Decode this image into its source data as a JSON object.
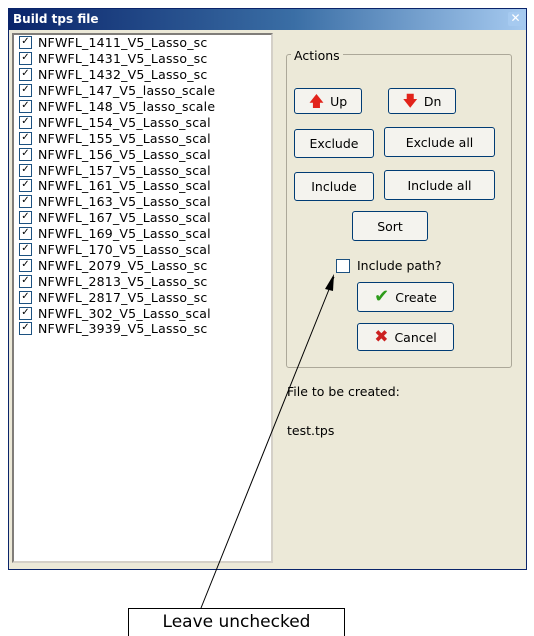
{
  "window": {
    "title": "Build tps file",
    "close_icon": "close-icon"
  },
  "files": [
    "NFWFL_1411_V5_Lasso_sc",
    "NFWFL_1431_V5_Lasso_sc",
    "NFWFL_1432_V5_Lasso_sc",
    "NFWFL_147_V5_lasso_scale",
    "NFWFL_148_V5_lasso_scale",
    "NFWFL_154_V5_Lasso_scal",
    "NFWFL_155_V5_Lasso_scal",
    "NFWFL_156_V5_Lasso_scal",
    "NFWFL_157_V5_Lasso_scal",
    "NFWFL_161_V5_Lasso_scal",
    "NFWFL_163_V5_Lasso_scal",
    "NFWFL_167_V5_Lasso_scal",
    "NFWFL_169_V5_Lasso_scal",
    "NFWFL_170_V5_Lasso_scal",
    "NFWFL_2079_V5_Lasso_sc",
    "NFWFL_2813_V5_Lasso_sc",
    "NFWFL_2817_V5_Lasso_sc",
    "NFWFL_302_V5_Lasso_scal",
    "NFWFL_3939_V5_Lasso_sc"
  ],
  "actions": {
    "group_title": "Actions",
    "up_label": "Up",
    "dn_label": "Dn",
    "exclude_label": "Exclude",
    "exclude_all_label": "Exclude all",
    "include_label": "Include",
    "include_all_label": "Include all",
    "sort_label": "Sort",
    "include_path_label": "Include path?",
    "create_label": "Create",
    "cancel_label": "Cancel"
  },
  "output": {
    "caption": "File to be created:",
    "filename": "test.tps"
  },
  "annotation": {
    "text": "Leave unchecked"
  },
  "colors": {
    "title_bar": "#0a246a",
    "window_bg": "#ece9d8",
    "arrow_red": "#e2231a",
    "check_green": "#2d9b1a",
    "cancel_red": "#cc2020"
  }
}
